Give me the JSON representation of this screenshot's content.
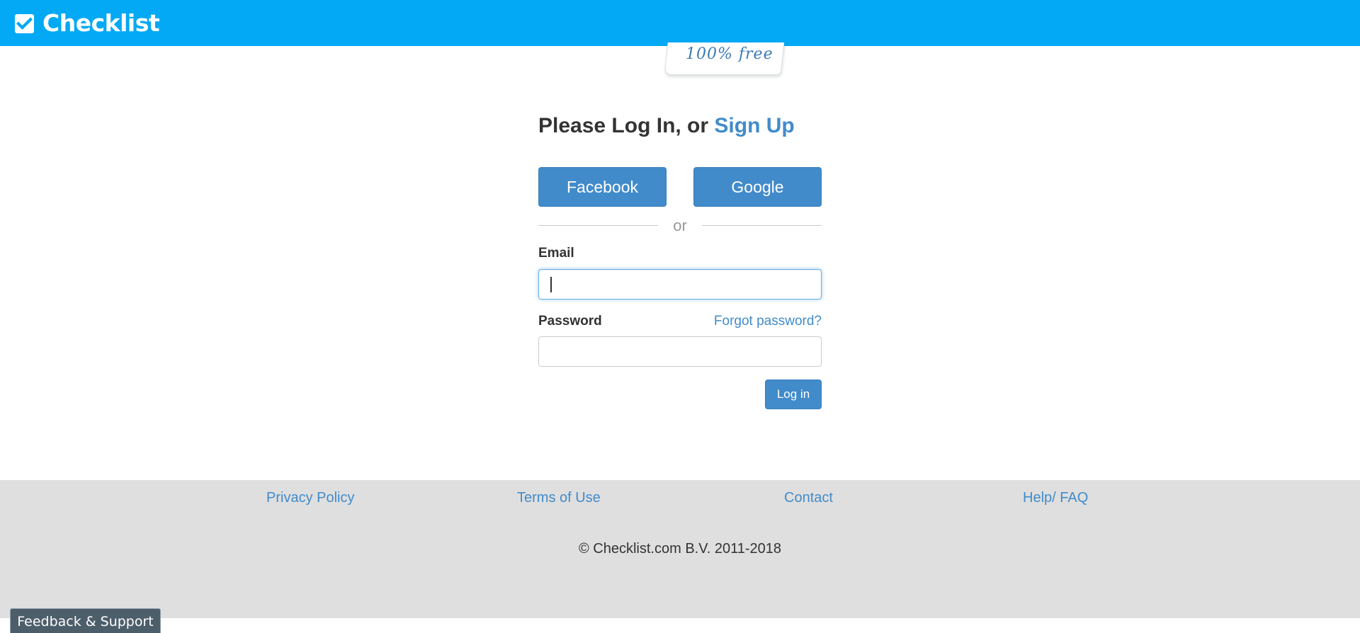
{
  "header": {
    "brand": "Checklist",
    "logo_icon": "checkbox-check-icon",
    "background_color": "#03a9f4"
  },
  "badge": {
    "text": "100% free"
  },
  "login": {
    "title_prefix": "Please Log In, or ",
    "signup_link": "Sign Up",
    "facebook_button": "Facebook",
    "google_button": "Google",
    "divider_text": "or",
    "email_label": "Email",
    "email_value": "",
    "password_label": "Password",
    "forgot_password_link": "Forgot password?",
    "password_value": "",
    "login_button": "Log in",
    "accent_color": "#428bca"
  },
  "footer": {
    "links": [
      "Privacy Policy",
      "Terms of Use",
      "Contact",
      "Help/ FAQ"
    ],
    "copyright": "© Checklist.com B.V. 2011-2018",
    "background_color": "#dfdfdf"
  },
  "feedback_tab": {
    "label": "Feedback & Support"
  }
}
